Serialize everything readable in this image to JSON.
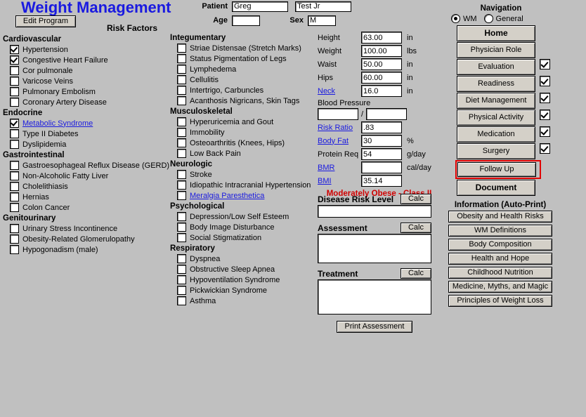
{
  "app": {
    "title": "Weight Management",
    "edit_program_label": "Edit Program",
    "risk_factors_label": "Risk Factors",
    "accent_color": "#1a1ae0",
    "warning_color": "#d00000",
    "highlight_color": "#e00000",
    "background_color": "#c0c0c0"
  },
  "patient": {
    "patient_label": "Patient",
    "first_name": "Greg",
    "last_name": "Test Jr",
    "age_label": "Age",
    "age": "",
    "sex_label": "Sex",
    "sex": "M"
  },
  "risk_factors": {
    "columns": [
      {
        "sections": [
          {
            "heading": "Cardiovascular",
            "items": [
              {
                "label": "Hypertension",
                "checked": true,
                "link": false
              },
              {
                "label": "Congestive Heart Failure",
                "checked": true,
                "link": false
              },
              {
                "label": "Cor pulmonale",
                "checked": false,
                "link": false
              },
              {
                "label": "Varicose Veins",
                "checked": false,
                "link": false
              },
              {
                "label": "Pulmonary Embolism",
                "checked": false,
                "link": false
              },
              {
                "label": "Coronary Artery Disease",
                "checked": false,
                "link": false
              }
            ]
          },
          {
            "heading": "Endocrine",
            "items": [
              {
                "label": "Metabolic Syndrome",
                "checked": true,
                "link": true
              },
              {
                "label": "Type II Diabetes",
                "checked": false,
                "link": false
              },
              {
                "label": "Dyslipidemia",
                "checked": false,
                "link": false
              }
            ]
          },
          {
            "heading": "Gastrointestinal",
            "items": [
              {
                "label": "Gastroesophageal Reflux Disease (GERD)",
                "checked": false,
                "link": false
              },
              {
                "label": "Non-Alcoholic Fatty Liver",
                "checked": false,
                "link": false
              },
              {
                "label": "Cholelithiasis",
                "checked": false,
                "link": false
              },
              {
                "label": "Hernias",
                "checked": false,
                "link": false
              },
              {
                "label": "Colon Cancer",
                "checked": false,
                "link": false
              }
            ]
          },
          {
            "heading": "Genitourinary",
            "items": [
              {
                "label": "Urinary Stress Incontinence",
                "checked": false,
                "link": false
              },
              {
                "label": "Obesity-Related Glomerulopathy",
                "checked": false,
                "link": false
              },
              {
                "label": "Hypogonadism (male)",
                "checked": false,
                "link": false
              }
            ]
          }
        ]
      },
      {
        "sections": [
          {
            "heading": "Integumentary",
            "items": [
              {
                "label": "Striae Distensae (Stretch Marks)",
                "checked": false,
                "link": false
              },
              {
                "label": "Status Pigmentation of Legs",
                "checked": false,
                "link": false
              },
              {
                "label": "Lymphedema",
                "checked": false,
                "link": false
              },
              {
                "label": "Cellulitis",
                "checked": false,
                "link": false
              },
              {
                "label": "Intertrigo, Carbuncles",
                "checked": false,
                "link": false
              },
              {
                "label": "Acanthosis Nigricans, Skin Tags",
                "checked": false,
                "link": false
              }
            ]
          },
          {
            "heading": "Musculoskeletal",
            "items": [
              {
                "label": "Hyperuricemia and Gout",
                "checked": false,
                "link": false
              },
              {
                "label": "Immobility",
                "checked": false,
                "link": false
              },
              {
                "label": "Osteoarthritis (Knees, Hips)",
                "checked": false,
                "link": false
              },
              {
                "label": "Low Back Pain",
                "checked": false,
                "link": false
              }
            ]
          },
          {
            "heading": "Neurologic",
            "items": [
              {
                "label": "Stroke",
                "checked": false,
                "link": false
              },
              {
                "label": "Idiopathic Intracranial Hypertension",
                "checked": false,
                "link": false
              },
              {
                "label": "Meralgia Paresthetica",
                "checked": false,
                "link": true
              }
            ]
          },
          {
            "heading": "Psychological",
            "items": [
              {
                "label": "Depression/Low Self Esteem",
                "checked": false,
                "link": false
              },
              {
                "label": "Body Image Disturbance",
                "checked": false,
                "link": false
              },
              {
                "label": "Social Stigmatization",
                "checked": false,
                "link": false
              }
            ]
          },
          {
            "heading": "Respiratory",
            "items": [
              {
                "label": "Dyspnea",
                "checked": false,
                "link": false
              },
              {
                "label": "Obstructive Sleep Apnea",
                "checked": false,
                "link": false
              },
              {
                "label": "Hypoventilation Syndrome",
                "checked": false,
                "link": false
              },
              {
                "label": "Pickwickian Syndrome",
                "checked": false,
                "link": false
              },
              {
                "label": "Asthma",
                "checked": false,
                "link": false
              }
            ]
          }
        ]
      }
    ]
  },
  "measurements": {
    "rows": [
      {
        "label": "Height",
        "value": "63.00",
        "unit": "in",
        "link": false
      },
      {
        "label": "Weight",
        "value": "100.00",
        "unit": "lbs",
        "link": false
      },
      {
        "label": "Waist",
        "value": "50.00",
        "unit": "in",
        "link": false
      },
      {
        "label": "Hips",
        "value": "60.00",
        "unit": "in",
        "link": false
      },
      {
        "label": "Neck",
        "value": "16.0",
        "unit": "in",
        "link": true
      }
    ],
    "blood_pressure": {
      "caption": "Blood Pressure",
      "systolic": "",
      "diastolic": "",
      "separator": "/"
    },
    "derived_rows": [
      {
        "label": "Risk Ratio",
        "value": ".83",
        "unit": "",
        "link": true
      },
      {
        "label": "Body Fat",
        "value": "30",
        "unit": "%",
        "link": true
      },
      {
        "label": "Protein Req",
        "value": "54",
        "unit": "g/day",
        "link": false
      },
      {
        "label": "BMR",
        "value": "",
        "unit": "cal/day",
        "link": true
      },
      {
        "label": "BMI",
        "value": "35.14",
        "unit": "",
        "link": true
      }
    ],
    "obesity_class": "Moderately Obese - Class II"
  },
  "assessment": {
    "calc_label": "Calc",
    "blocks": [
      {
        "title": "Disease Risk Level",
        "value": ""
      },
      {
        "title": "Assessment",
        "value": ""
      },
      {
        "title": "Treatment",
        "value": ""
      }
    ],
    "print_label": "Print Assessment"
  },
  "navigation": {
    "title": "Navigation",
    "radios": [
      {
        "label": "WM",
        "selected": true
      },
      {
        "label": "General",
        "selected": false
      }
    ],
    "buttons": [
      {
        "label": "Home",
        "bold": true,
        "checkbox": null,
        "highlighted": false
      },
      {
        "label": "Physician Role",
        "bold": false,
        "checkbox": null,
        "highlighted": false
      },
      {
        "label": "Evaluation",
        "bold": false,
        "checkbox": true,
        "highlighted": false
      },
      {
        "label": "Readiness",
        "bold": false,
        "checkbox": true,
        "highlighted": false
      },
      {
        "label": "Diet Management",
        "bold": false,
        "checkbox": true,
        "highlighted": false
      },
      {
        "label": "Physical Activity",
        "bold": false,
        "checkbox": true,
        "highlighted": false
      },
      {
        "label": "Medication",
        "bold": false,
        "checkbox": true,
        "highlighted": false
      },
      {
        "label": "Surgery",
        "bold": false,
        "checkbox": true,
        "highlighted": false
      },
      {
        "label": "Follow Up",
        "bold": false,
        "checkbox": null,
        "highlighted": true
      },
      {
        "label": "Document",
        "bold": true,
        "checkbox": null,
        "highlighted": false
      }
    ]
  },
  "information": {
    "title": "Information (Auto-Print)",
    "buttons": [
      {
        "label": "Obesity and Health Risks"
      },
      {
        "label": "WM Definitions"
      },
      {
        "label": "Body Composition"
      },
      {
        "label": "Health and Hope"
      },
      {
        "label": "Childhood Nutrition"
      },
      {
        "label": "Medicine, Myths, and Magic"
      },
      {
        "label": "Principles of Weight Loss"
      }
    ]
  }
}
